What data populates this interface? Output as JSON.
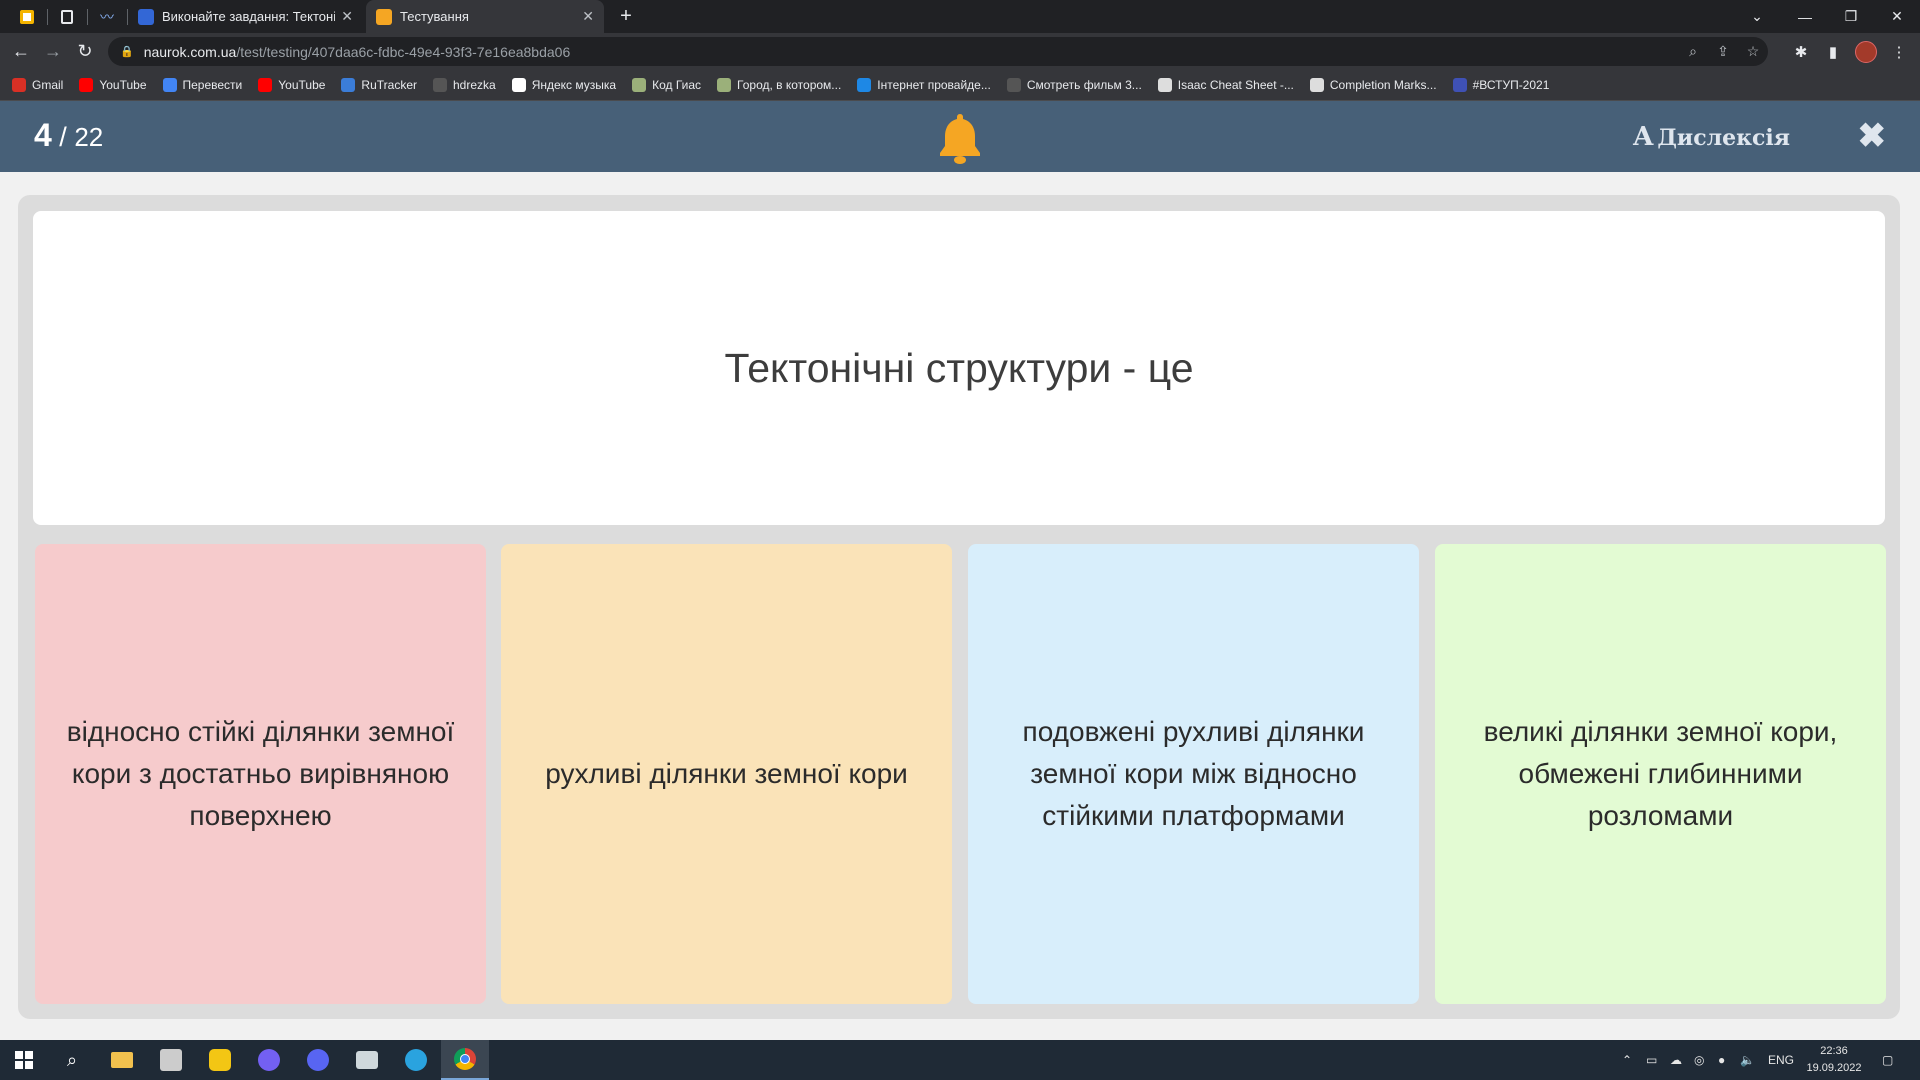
{
  "browser": {
    "tabs": [
      {
        "title": "Виконайте завдання: Тектонічні",
        "active": false
      },
      {
        "title": "Тестування",
        "active": true
      }
    ],
    "new_tab_label": "+",
    "url_host": "naurok.com.ua",
    "url_path": "/test/testing/407daa6c-fdbc-49e4-93f3-7e16ea8bda06",
    "bookmarks": [
      {
        "label": "Gmail",
        "icon": "gmail-icon",
        "color": "#d93025"
      },
      {
        "label": "YouTube",
        "icon": "youtube-icon",
        "color": "#ff0000"
      },
      {
        "label": "Перевести",
        "icon": "translate-icon",
        "color": "#4285f4"
      },
      {
        "label": "YouTube",
        "icon": "youtube-icon",
        "color": "#ff0000"
      },
      {
        "label": "RuTracker",
        "icon": "rutracker-icon",
        "color": "#3b7dd8"
      },
      {
        "label": "hdrezka",
        "icon": "hd-icon",
        "color": "#555555"
      },
      {
        "label": "Яндекс музыка",
        "icon": "play-icon",
        "color": "#ffffff"
      },
      {
        "label": "Код Гиас",
        "icon": "site-icon",
        "color": "#9bb07a"
      },
      {
        "label": "Город, в котором...",
        "icon": "site-icon",
        "color": "#9bb07a"
      },
      {
        "label": "Інтернет провайде...",
        "icon": "provider-icon",
        "color": "#1e88e5"
      },
      {
        "label": "Смотреть фильм 3...",
        "icon": "hd-icon",
        "color": "#555555"
      },
      {
        "label": "Isaac Cheat Sheet -...",
        "icon": "isaac-icon",
        "color": "#dddddd"
      },
      {
        "label": "Completion Marks...",
        "icon": "isaac-icon",
        "color": "#dddddd"
      },
      {
        "label": "#ВСТУП-2021",
        "icon": "vstup-icon",
        "color": "#3f51b5"
      }
    ]
  },
  "quiz": {
    "current": "4",
    "separator": " / ",
    "total": "22",
    "dyslexia_glyph": "A",
    "dyslexia_label": "Дислексія",
    "question": "Тектонічні структури - це",
    "answers": [
      {
        "text": "відносно стійкі ділянки земної кори з достатньо вирівняною поверхнею",
        "color": "#f6cbcc"
      },
      {
        "text": "рухливі ділянки земної кори",
        "color": "#fae3b8"
      },
      {
        "text": "подовжені рухливі ділянки земної кори між відносно стійкими платформами",
        "color": "#d8eefb"
      },
      {
        "text": "великі ділянки земної кори, обмежені глибинними розломами",
        "color": "#e3fbd3"
      }
    ]
  },
  "taskbar": {
    "lang": "ENG",
    "time": "22:36",
    "date": "19.09.2022"
  },
  "colors": {
    "header": "#476078",
    "bell": "#f5a623"
  }
}
